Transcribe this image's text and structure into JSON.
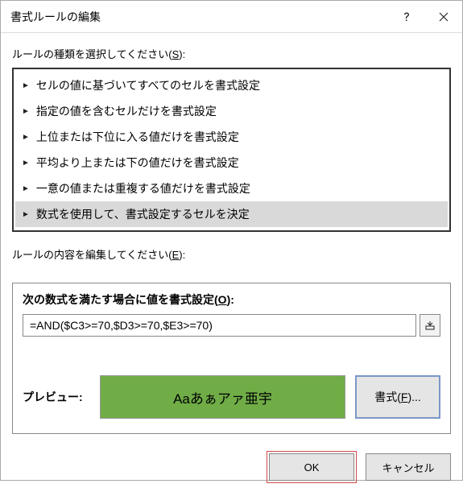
{
  "titlebar": {
    "title": "書式ルールの編集"
  },
  "select_label_pre": "ルールの種類を選択してください(",
  "select_label_key": "S",
  "select_label_post": "):",
  "rules": [
    "セルの値に基づいてすべてのセルを書式設定",
    "指定の値を含むセルだけを書式設定",
    "上位または下位に入る値だけを書式設定",
    "平均より上または下の値だけを書式設定",
    "一意の値または重複する値だけを書式設定",
    "数式を使用して、書式設定するセルを決定"
  ],
  "edit_label_pre": "ルールの内容を編集してください(",
  "edit_label_key": "E",
  "edit_label_post": "):",
  "formula_heading_pre": "次の数式を満たす場合に値を書式設定(",
  "formula_heading_key": "O",
  "formula_heading_post": "):",
  "formula_value": "=AND($C3>=70,$D3>=70,$E3>=70)",
  "preview_label": "プレビュー:",
  "preview_text": "Aaあぁアァ亜宇",
  "format_btn_pre": "書式(",
  "format_btn_key": "F",
  "format_btn_post": ")...",
  "footer": {
    "ok": "OK",
    "cancel": "キャンセル"
  }
}
